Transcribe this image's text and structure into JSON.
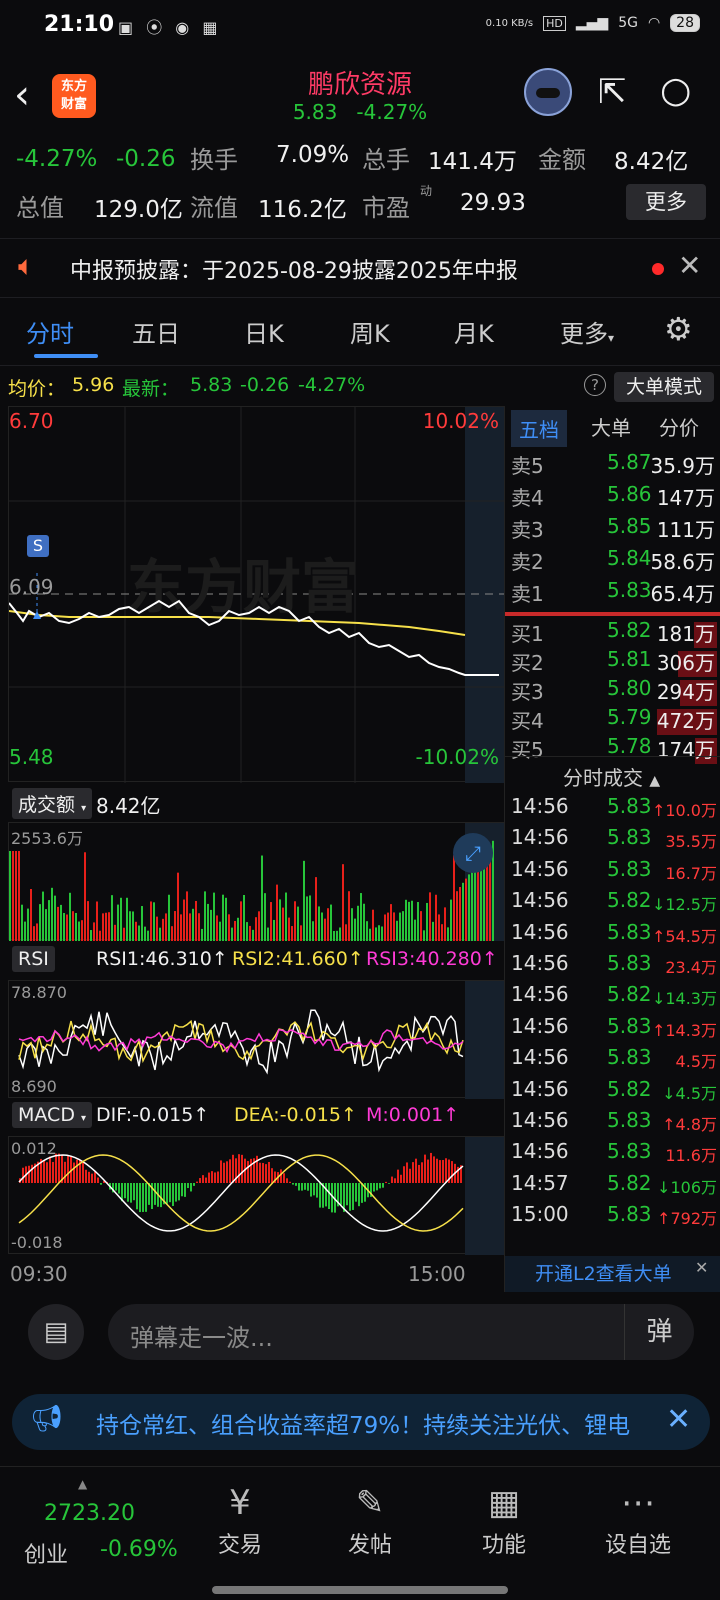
{
  "status": {
    "time": "21:10",
    "net_speed": "0.10 KB/s",
    "hd": "HD",
    "signal": "5G",
    "battery": "28"
  },
  "header": {
    "logo_line1": "东方",
    "logo_line2": "财富",
    "stock_name": "鹏欣资源",
    "price": "5.83",
    "change_pct": "-4.27%"
  },
  "quote": {
    "change_pct": "-4.27%",
    "change": "-0.26",
    "turnover_label": "换手",
    "turnover": "7.09%",
    "volume_label": "总手",
    "volume": "141.4万",
    "amount_label": "金额",
    "amount": "8.42亿",
    "mktcap_label": "总值",
    "mktcap": "129.0亿",
    "float_label": "流值",
    "float": "116.2亿",
    "pe_label": "市盈",
    "pe_sup": "动",
    "pe": "29.93",
    "more": "更多"
  },
  "notice": {
    "text": "中报预披露：于2025-08-29披露2025年中报"
  },
  "tabs": [
    "分时",
    "五日",
    "日K",
    "周K",
    "月K",
    "更多"
  ],
  "avgrow": {
    "avg_label": "均价：",
    "avg": "5.96",
    "latest_label": "最新：",
    "latest": "5.83",
    "chg": "-0.26",
    "pct": "-4.27%",
    "help": "?",
    "big_order_mode": "大单模式"
  },
  "price_chart": {
    "high_price": "6.70",
    "high_pct": "10.02%",
    "low_price": "5.48",
    "low_pct": "-10.02%",
    "prev_close": "6.09",
    "watermark": "东方财富",
    "s_marker": "S"
  },
  "volume_pane": {
    "label": "成交额",
    "total": "8.42亿",
    "max": "2553.6万"
  },
  "rsi_pane": {
    "label": "RSI",
    "rsi1": "RSI1:46.310↑",
    "rsi2": "RSI2:41.660↑",
    "rsi3": "RSI3:40.280↑",
    "max": "78.870",
    "min": "8.690"
  },
  "macd_pane": {
    "label": "MACD",
    "dif": "DIF:-0.015↑",
    "dea": "DEA:-0.015↑",
    "m": "M:0.001↑",
    "max": "0.012",
    "min": "-0.018"
  },
  "time_axis": {
    "start": "09:30",
    "end": "15:00"
  },
  "right_panel": {
    "tabs": [
      "五档",
      "大单",
      "分价"
    ],
    "sells": [
      {
        "label": "卖5",
        "price": "5.87",
        "vol": "35.9万"
      },
      {
        "label": "卖4",
        "price": "5.86",
        "vol": "147万"
      },
      {
        "label": "卖3",
        "price": "5.85",
        "vol": "111万"
      },
      {
        "label": "卖2",
        "price": "5.84",
        "vol": "58.6万"
      },
      {
        "label": "卖1",
        "price": "5.83",
        "vol": "65.4万"
      }
    ],
    "buys": [
      {
        "label": "买1",
        "price": "5.82",
        "vol": "181万",
        "bar": 0.38
      },
      {
        "label": "买2",
        "price": "5.81",
        "vol": "306万",
        "bar": 0.65
      },
      {
        "label": "买3",
        "price": "5.80",
        "vol": "294万",
        "bar": 0.62
      },
      {
        "label": "买4",
        "price": "5.79",
        "vol": "472万",
        "bar": 1.0
      },
      {
        "label": "买5",
        "price": "5.78",
        "vol": "174万",
        "bar": 0.37
      }
    ],
    "tick_header": "分时成交",
    "ticks": [
      {
        "time": "14:56",
        "price": "5.83",
        "vol": "↑10.0万",
        "dir": "up"
      },
      {
        "time": "14:56",
        "price": "5.83",
        "vol": "35.5万",
        "dir": "up"
      },
      {
        "time": "14:56",
        "price": "5.83",
        "vol": "16.7万",
        "dir": "up"
      },
      {
        "time": "14:56",
        "price": "5.82",
        "vol": "↓12.5万",
        "dir": "down"
      },
      {
        "time": "14:56",
        "price": "5.83",
        "vol": "↑54.5万",
        "dir": "up"
      },
      {
        "time": "14:56",
        "price": "5.83",
        "vol": "23.4万",
        "dir": "up"
      },
      {
        "time": "14:56",
        "price": "5.82",
        "vol": "↓14.3万",
        "dir": "down"
      },
      {
        "time": "14:56",
        "price": "5.83",
        "vol": "↑14.3万",
        "dir": "up"
      },
      {
        "time": "14:56",
        "price": "5.83",
        "vol": "4.5万",
        "dir": "up"
      },
      {
        "time": "14:56",
        "price": "5.82",
        "vol": "↓4.5万",
        "dir": "down"
      },
      {
        "time": "14:56",
        "price": "5.83",
        "vol": "↑4.8万",
        "dir": "up"
      },
      {
        "time": "14:56",
        "price": "5.83",
        "vol": "11.6万",
        "dir": "up"
      },
      {
        "time": "14:57",
        "price": "5.82",
        "vol": "↓106万",
        "dir": "down"
      },
      {
        "time": "15:00",
        "price": "5.83",
        "vol": "↑792万",
        "dir": "up"
      }
    ],
    "l2_link": "开通L2查看大单"
  },
  "danmu": {
    "placeholder": "弹幕走一波...",
    "btn": "弹"
  },
  "promo": {
    "text": "持仓常红、组合收益率超79%！持续关注光伏、锂电"
  },
  "bottom_nav": {
    "index_value": "2723.20",
    "index_name": "创业",
    "index_change": "-0.69%",
    "items": [
      "交易",
      "发帖",
      "功能",
      "设自选"
    ]
  },
  "colors": {
    "up": "#ff3b3b",
    "down": "#27c53a",
    "accent": "#3f8ef5",
    "avg_line": "#f6e04a"
  }
}
